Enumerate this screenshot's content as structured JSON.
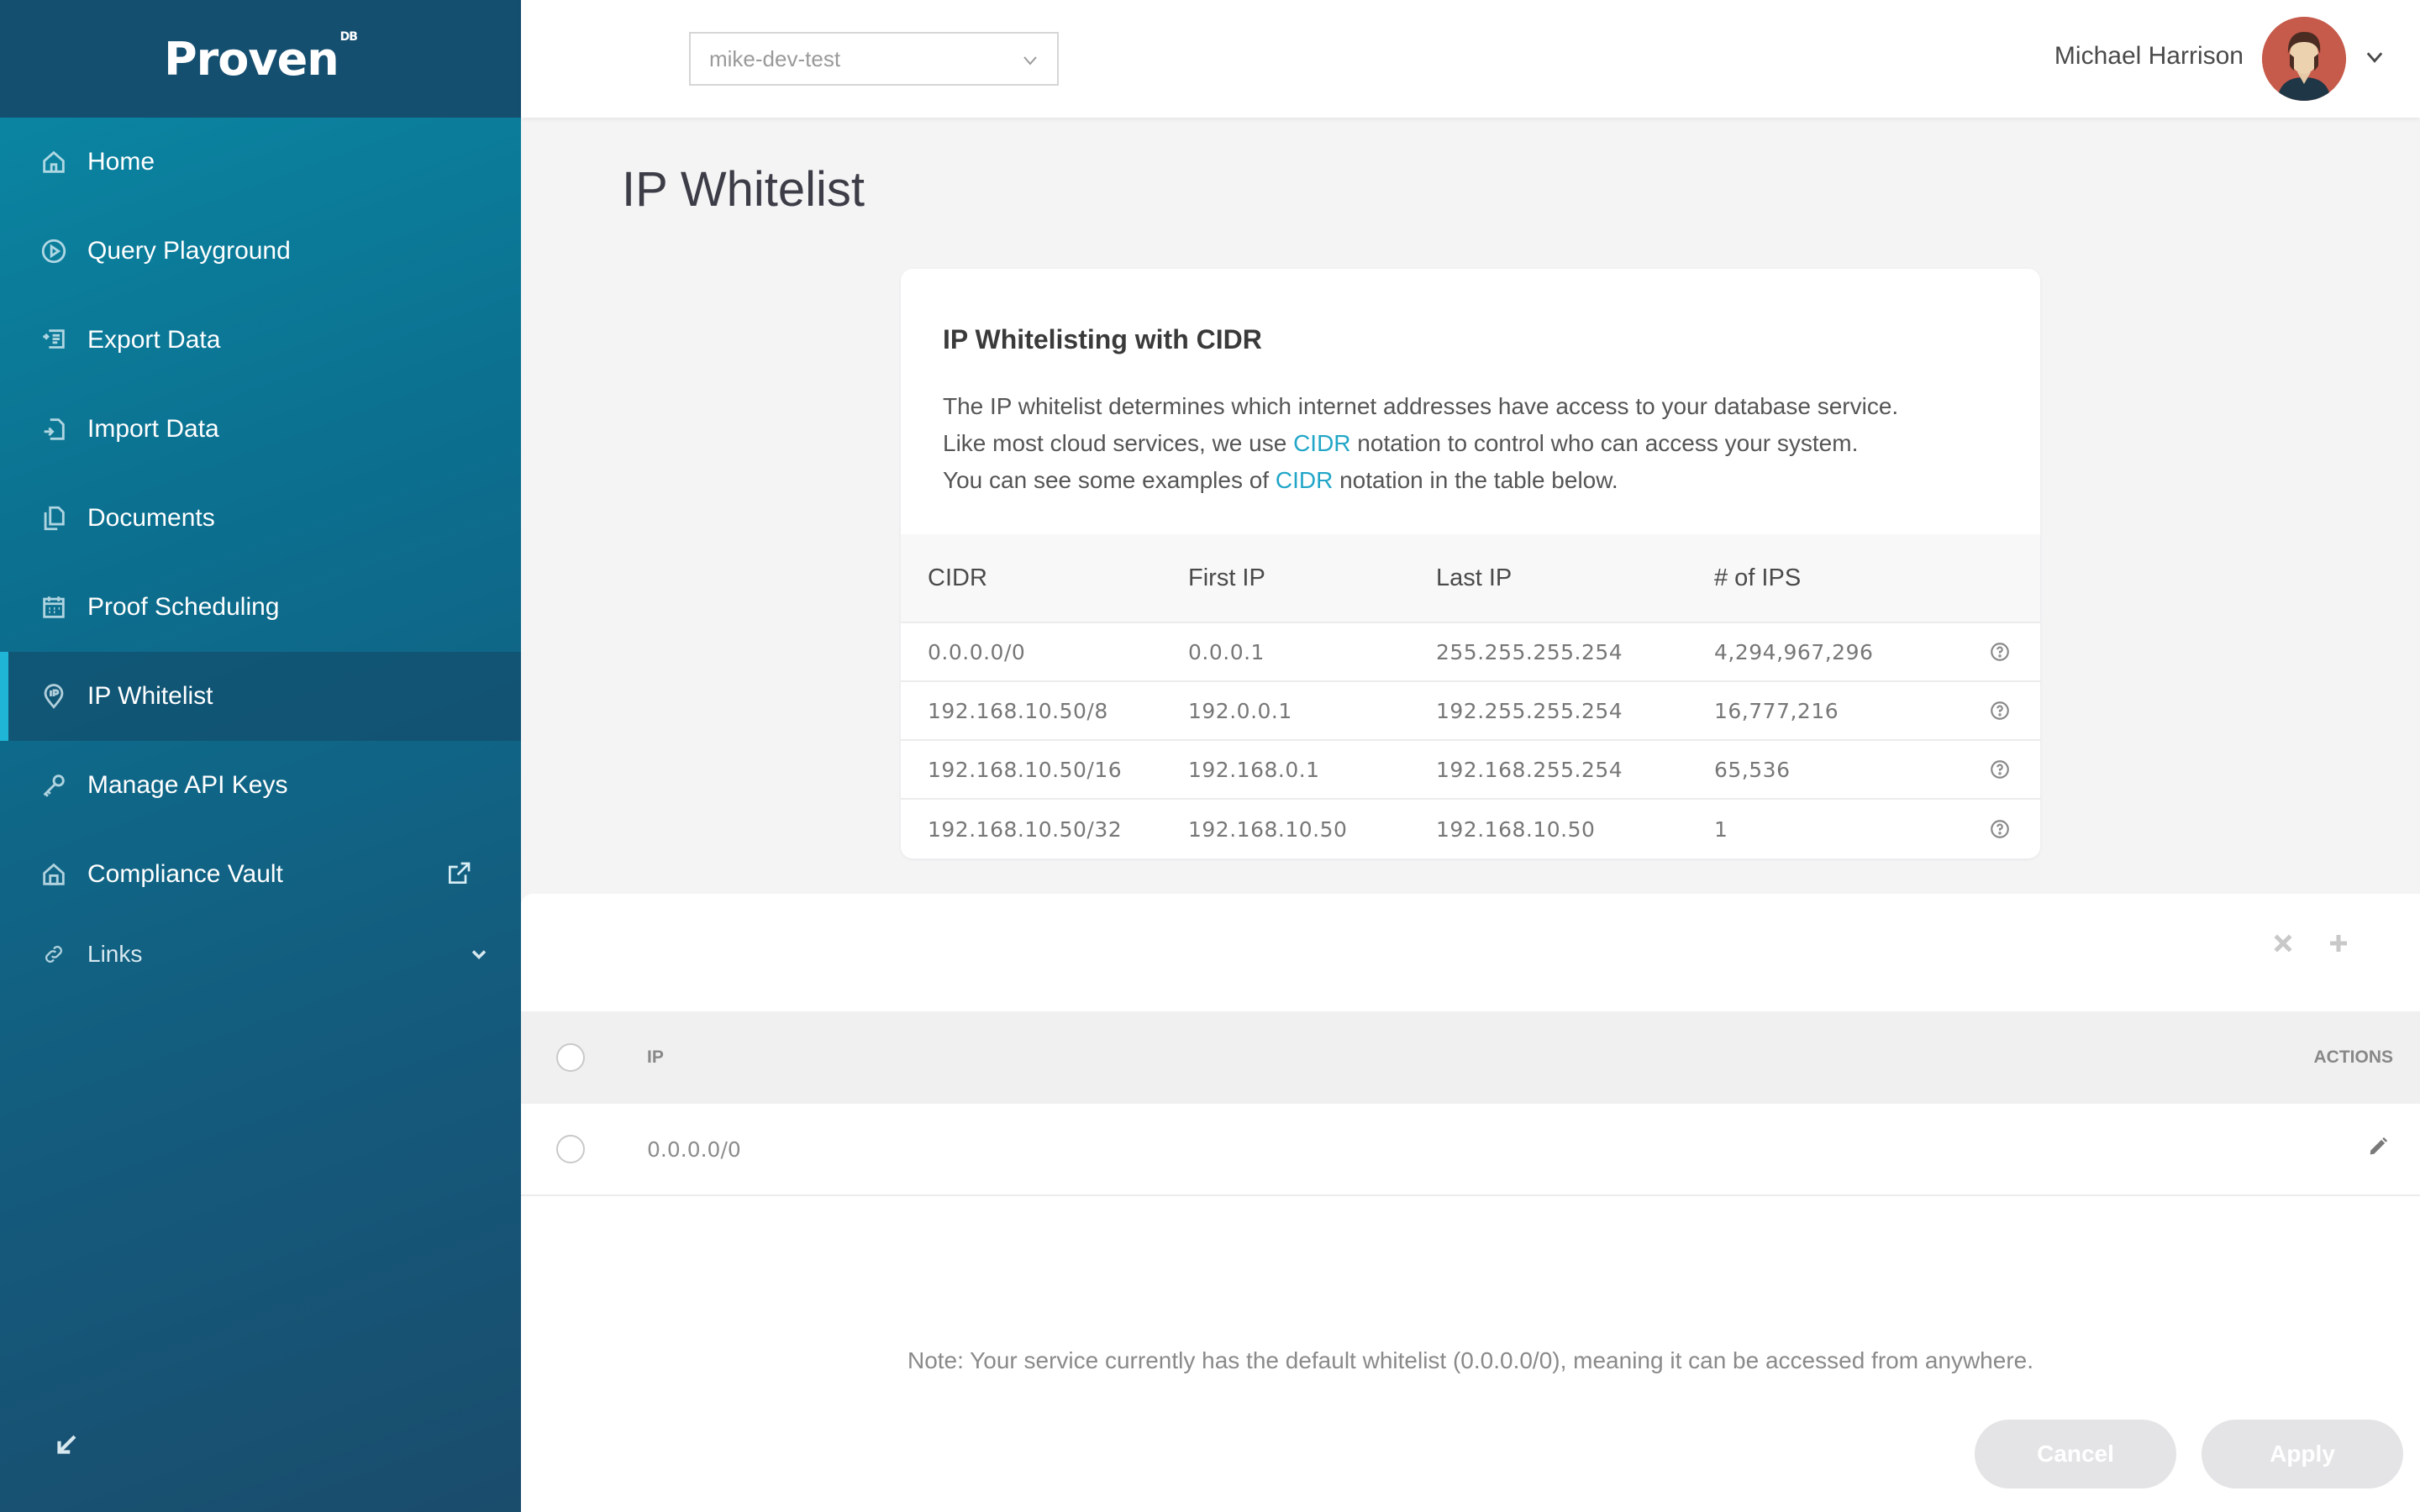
{
  "app": {
    "logo": "Proven",
    "logo_mark": "DB"
  },
  "sidebar": {
    "items": [
      {
        "label": "Home",
        "icon": "home-icon"
      },
      {
        "label": "Query Playground",
        "icon": "play-circle-icon"
      },
      {
        "label": "Export Data",
        "icon": "export-icon"
      },
      {
        "label": "Import Data",
        "icon": "import-icon"
      },
      {
        "label": "Documents",
        "icon": "documents-icon"
      },
      {
        "label": "Proof Scheduling",
        "icon": "calendar-icon"
      },
      {
        "label": "IP Whitelist",
        "icon": "ip-pin-icon",
        "active": true
      },
      {
        "label": "Manage API Keys",
        "icon": "key-icon"
      },
      {
        "label": "Compliance Vault",
        "icon": "vault-icon"
      }
    ],
    "links_label": "Links"
  },
  "header": {
    "service_select": "mike-dev-test",
    "user_name": "Michael Harrison"
  },
  "page": {
    "title": "IP Whitelist"
  },
  "info": {
    "heading": "IP Whitelisting with CIDR",
    "line1": "The IP whitelist determines which internet addresses have access to your database service.",
    "line2_pre": "Like most cloud services, we use ",
    "line2_link": "CIDR",
    "line2_post": " notation to control who can access your system.",
    "line3_pre": "You can see some examples of ",
    "line3_link": "CIDR",
    "line3_post": " notation in the table below.",
    "table": {
      "headers": [
        "CIDR",
        "First IP",
        "Last IP",
        "# of IPS"
      ],
      "rows": [
        [
          "0.0.0.0/0",
          "0.0.0.1",
          "255.255.255.254",
          "4,294,967,296"
        ],
        [
          "192.168.10.50/8",
          "192.0.0.1",
          "192.255.255.254",
          "16,777,216"
        ],
        [
          "192.168.10.50/16",
          "192.168.0.1",
          "192.168.255.254",
          "65,536"
        ],
        [
          "192.168.10.50/32",
          "192.168.10.50",
          "192.168.10.50",
          "1"
        ]
      ]
    }
  },
  "whitelist": {
    "col_ip": "IP",
    "col_actions": "ACTIONS",
    "entries": [
      "0.0.0.0/0"
    ],
    "note": "Note: Your service currently has the default whitelist (0.0.0.0/0), meaning it can be accessed from anywhere.",
    "cancel_label": "Cancel",
    "apply_label": "Apply"
  },
  "colors": {
    "accent": "#21a6c8",
    "sidebar_top": "#154f70",
    "sidebar_gradient_start": "#0a8aa6",
    "sidebar_gradient_end": "#1a4c6c"
  }
}
